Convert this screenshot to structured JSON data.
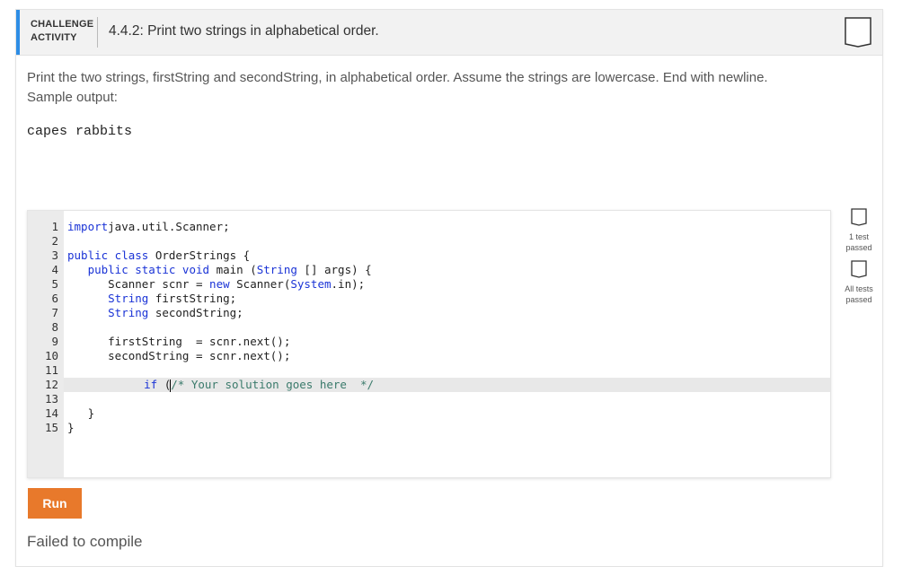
{
  "header": {
    "activity_label_line1": "CHALLENGE",
    "activity_label_line2": "ACTIVITY",
    "title": "4.4.2: Print two strings in alphabetical order.",
    "accent_color": "#2d8de5"
  },
  "prompt": {
    "text_line1": "Print the two strings, firstString and secondString, in alphabetical order. Assume the strings are lowercase. End with newline.",
    "text_line2": "Sample output:",
    "sample_output": "capes rabbits"
  },
  "editor": {
    "lines": [
      {
        "num": "1",
        "parts": [
          [
            "kw",
            "import"
          ],
          [
            "",
            "java.util.Scanner;"
          ]
        ]
      },
      {
        "num": "2",
        "parts": []
      },
      {
        "num": "3",
        "parts": [
          [
            "kw",
            "public class"
          ],
          [
            "",
            " OrderStrings {"
          ]
        ]
      },
      {
        "num": "4",
        "parts": [
          [
            "",
            "   "
          ],
          [
            "kw",
            "public static void"
          ],
          [
            "",
            " main ("
          ],
          [
            "ty",
            "String"
          ],
          [
            "",
            " [] args) {"
          ]
        ]
      },
      {
        "num": "5",
        "parts": [
          [
            "",
            "      Scanner scnr = "
          ],
          [
            "kw",
            "new"
          ],
          [
            "",
            " Scanner("
          ],
          [
            "ty",
            "System"
          ],
          [
            "",
            ".in);"
          ]
        ]
      },
      {
        "num": "6",
        "parts": [
          [
            "",
            "      "
          ],
          [
            "ty",
            "String"
          ],
          [
            "",
            " firstString;"
          ]
        ]
      },
      {
        "num": "7",
        "parts": [
          [
            "",
            "      "
          ],
          [
            "ty",
            "String"
          ],
          [
            "",
            " secondString;"
          ]
        ]
      },
      {
        "num": "8",
        "parts": []
      },
      {
        "num": "9",
        "parts": [
          [
            "",
            "      firstString  = scnr.next();"
          ]
        ]
      },
      {
        "num": "10",
        "parts": [
          [
            "",
            "      secondString = scnr.next();"
          ]
        ]
      },
      {
        "num": "11",
        "parts": []
      },
      {
        "num": "12",
        "parts": [
          [
            "",
            "      "
          ],
          [
            "kw",
            "if"
          ],
          [
            "",
            " ("
          ],
          [
            "cursor",
            ""
          ],
          [
            "cm",
            "/* Your solution goes here  */"
          ]
        ]
      },
      {
        "num": "13",
        "parts": []
      },
      {
        "num": "14",
        "parts": [
          [
            "",
            "   }"
          ]
        ]
      },
      {
        "num": "15",
        "parts": [
          [
            "",
            "}"
          ]
        ]
      }
    ],
    "active_line": "12"
  },
  "run_button": {
    "label": "Run",
    "color": "#e8792b"
  },
  "status": {
    "text": "Failed to compile"
  },
  "side_status": {
    "test1_line1": "1 test",
    "test1_line2": "passed",
    "test2_line1": "All tests",
    "test2_line2": "passed"
  }
}
